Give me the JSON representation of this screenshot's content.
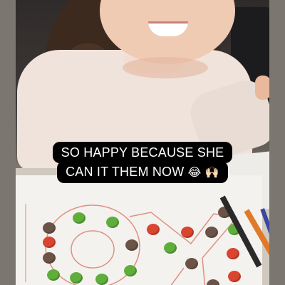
{
  "caption": {
    "line1": "SO HAPPY BECAUSE SHE",
    "line2": "CAN IT THEM NOW",
    "emoji1": "😂",
    "emoji2": "🙌🏻"
  },
  "colors": {
    "caption_bg": "#000000",
    "caption_text": "#ffffff",
    "cereal_green": "#5fae3c",
    "cereal_red": "#d9452f",
    "cereal_brown": "#6b5347"
  }
}
